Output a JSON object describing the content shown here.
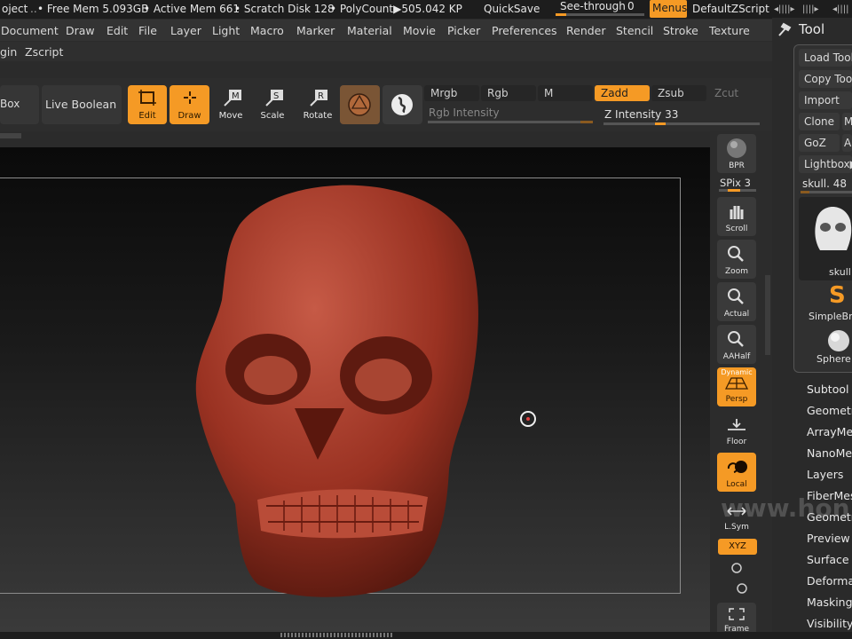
{
  "topbar": {
    "project_label": "oject",
    "free_mem": "• Free Mem 5.093GB",
    "active_mem": "• Active Mem 661",
    "scratch_disk": "• Scratch Disk 128",
    "polycount": "• PolyCount▶505.042 KP",
    "quicksave": "QuickSave",
    "see_through_label": "See-through",
    "see_through_value": "0",
    "menus_label": "Menus",
    "script_name": "DefaultZScript"
  },
  "menus": [
    "Document",
    "Draw",
    "Edit",
    "File",
    "Layer",
    "Light",
    "Macro",
    "Marker",
    "Material",
    "Movie",
    "Picker",
    "Preferences",
    "Render",
    "Stencil",
    "Stroke",
    "Texture"
  ],
  "menus_row2": [
    "gin",
    "Zscript"
  ],
  "shelf": {
    "box_label": "Box",
    "live_boolean": "Live Boolean",
    "edit": "Edit",
    "draw": "Draw",
    "move": "Move",
    "scale": "Scale",
    "rotate": "Rotate",
    "mrgb": "Mrgb",
    "rgb": "Rgb",
    "m": "M",
    "zadd": "Zadd",
    "zsub": "Zsub",
    "zcut": "Zcut",
    "rgb_intensity": "Rgb Intensity",
    "z_intensity_label": "Z Intensity",
    "z_intensity_value": "33",
    "z_intensity_fraction": 0.33
  },
  "right_strip": {
    "bpr": "BPR",
    "spix_label": "SPix",
    "spix_value": "3",
    "scroll": "Scroll",
    "zoom": "Zoom",
    "actual": "Actual",
    "aahalf": "AAHalf",
    "dynamic": "Dynamic",
    "persp": "Persp",
    "floor": "Floor",
    "local": "Local",
    "lsym": "L.Sym",
    "xyz": "XYZ",
    "frame": "Frame"
  },
  "tool_panel": {
    "title": "Tool",
    "load_tool": "Load Tool",
    "copy_tool": "Copy Tool",
    "import": "Import",
    "clone": "Clone",
    "goz": "GoZ",
    "lightbox": "Lightbox▶",
    "current_tool_label": "skull.",
    "current_tool_value": "48",
    "thumb_skull": "skull",
    "thumb_simplebrush": "SimpleBr",
    "thumb_sphere": "Sphere",
    "sections": [
      "Subtool",
      "Geometry",
      "ArrayMesh",
      "NanoMesh",
      "Layers",
      "FiberMesh",
      "Geometry",
      "Preview",
      "Surface",
      "Deformation",
      "Masking",
      "Visibility"
    ]
  },
  "watermark": "www.hon",
  "colors": {
    "accent": "#f59a25",
    "model": "#9a3222",
    "panel": "#2a2a2a"
  }
}
